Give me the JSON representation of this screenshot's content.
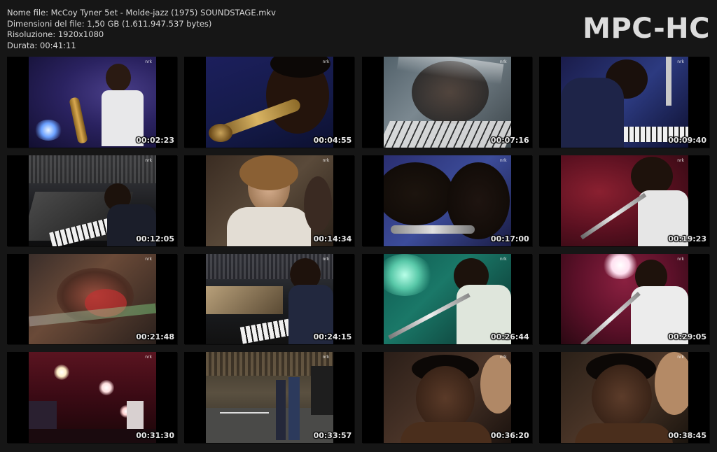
{
  "info": {
    "filename": "Nome file: McCoy Tyner 5et - Molde-jazz (1975) SOUNDSTAGE.mkv",
    "filesize": "Dimensioni del file: 1,50 GB (1.611.947.537 bytes)",
    "resolution": "Risoluzione: 1920x1080",
    "duration": "Durata: 00:41:11"
  },
  "brand": "MPC-HC",
  "thumbnails": [
    {
      "time": "00:02:23",
      "scene": "saxophonist-white-shirt-purple-stage",
      "channel_logo": "nrk"
    },
    {
      "time": "00:04:55",
      "scene": "saxophonist-closeup-blue",
      "channel_logo": "nrk"
    },
    {
      "time": "00:07:16",
      "scene": "pianist-double-exposure",
      "channel_logo": "nrk"
    },
    {
      "time": "00:09:40",
      "scene": "pianist-blue-light",
      "channel_logo": "nrk"
    },
    {
      "time": "00:12:05",
      "scene": "grand-piano-stage-wide",
      "channel_logo": "nrk"
    },
    {
      "time": "00:14:34",
      "scene": "audience-woman",
      "channel_logo": "nrk"
    },
    {
      "time": "00:17:00",
      "scene": "saxophone-double-exposure",
      "channel_logo": "nrk"
    },
    {
      "time": "00:19:23",
      "scene": "flutist-red-stage",
      "channel_logo": "nrk"
    },
    {
      "time": "00:21:48",
      "scene": "abstract-blur",
      "channel_logo": "nrk"
    },
    {
      "time": "00:24:15",
      "scene": "pianist-at-grand-piano",
      "channel_logo": "nrk"
    },
    {
      "time": "00:26:44",
      "scene": "flutist-green-light",
      "channel_logo": "nrk"
    },
    {
      "time": "00:29:05",
      "scene": "flutist-spotlight",
      "channel_logo": "nrk"
    },
    {
      "time": "00:31:30",
      "scene": "band-red-stage-lights",
      "channel_logo": "nrk"
    },
    {
      "time": "00:33:57",
      "scene": "empty-stage-setup",
      "channel_logo": "nrk"
    },
    {
      "time": "00:36:20",
      "scene": "musician-portrait",
      "channel_logo": "nrk"
    },
    {
      "time": "00:38:45",
      "scene": "musician-portrait-2",
      "channel_logo": "nrk"
    }
  ]
}
